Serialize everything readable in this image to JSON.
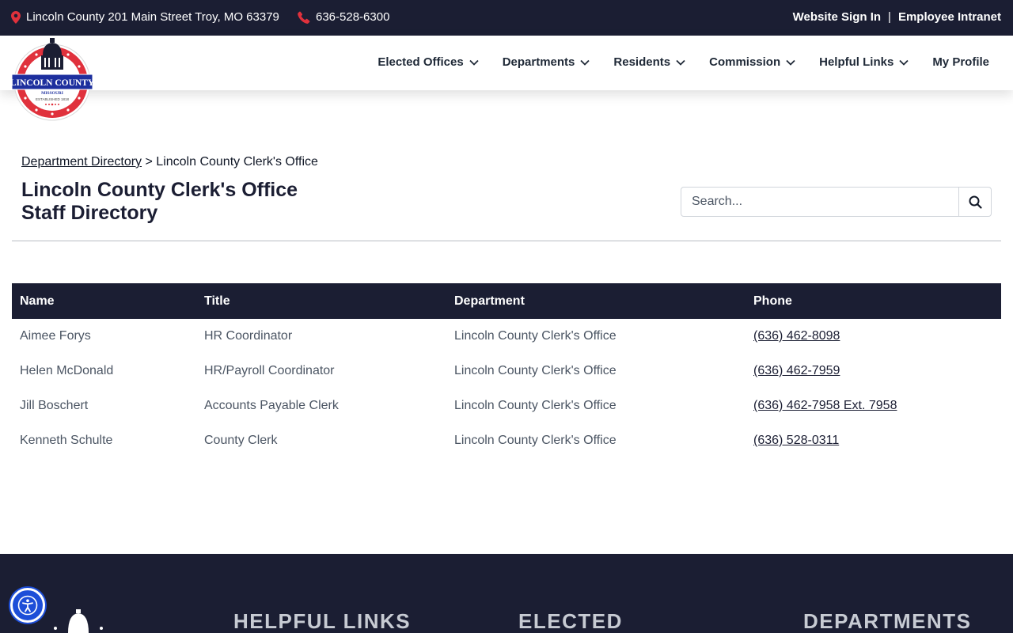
{
  "topbar": {
    "address": "Lincoln County 201 Main Street Troy, MO 63379",
    "phone": "636-528-6300",
    "sign_in": "Website Sign In",
    "separator": "|",
    "intranet": "Employee Intranet"
  },
  "logo": {
    "name": "LINCOLN COUNTY",
    "state": "MISSOURI",
    "established": "ESTABLISHED 1818"
  },
  "nav": {
    "items": [
      {
        "label": "Elected Offices",
        "dropdown": true
      },
      {
        "label": "Departments",
        "dropdown": true
      },
      {
        "label": "Residents",
        "dropdown": true
      },
      {
        "label": "Commission",
        "dropdown": true
      },
      {
        "label": "Helpful Links",
        "dropdown": true
      },
      {
        "label": "My Profile",
        "dropdown": false
      }
    ]
  },
  "breadcrumb": {
    "link": "Department Directory",
    "separator": ">",
    "current": "Lincoln County Clerk's Office"
  },
  "page": {
    "title_line1": "Lincoln County Clerk's Office",
    "title_line2": "Staff Directory"
  },
  "search": {
    "placeholder": "Search..."
  },
  "table": {
    "headers": [
      "Name",
      "Title",
      "Department",
      "Phone"
    ],
    "rows": [
      {
        "name": "Aimee Forys",
        "title": "HR Coordinator",
        "department": "Lincoln County Clerk's Office",
        "phone": "(636) 462-8098"
      },
      {
        "name": "Helen McDonald",
        "title": "HR/Payroll Coordinator",
        "department": "Lincoln County Clerk's Office",
        "phone": "(636) 462-7959"
      },
      {
        "name": "Jill Boschert",
        "title": "Accounts Payable Clerk",
        "department": "Lincoln County Clerk's Office",
        "phone": "(636) 462-7958 Ext. 7958"
      },
      {
        "name": "Kenneth Schulte",
        "title": "County Clerk",
        "department": "Lincoln County Clerk's Office",
        "phone": "(636) 528-0311"
      }
    ]
  },
  "footer": {
    "col1": "HELPFUL LINKS",
    "col2": "ELECTED",
    "col3": "DEPARTMENTS"
  },
  "colors": {
    "navy": "#1b1e33",
    "pin_red": "#e0313c",
    "accessibility_blue": "#1d4ed8"
  },
  "icons": {
    "location": "map-pin-icon",
    "phone": "phone-icon",
    "search": "search-icon",
    "dropdown": "chevron-down-icon",
    "accessibility": "accessibility-icon"
  }
}
